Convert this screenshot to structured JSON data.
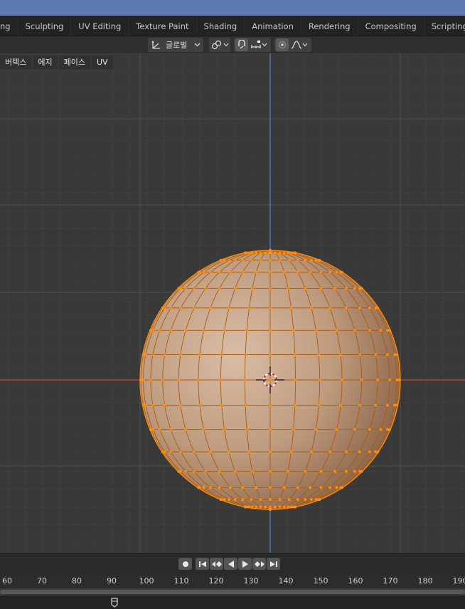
{
  "workspace_tabs": [
    {
      "label": "ng"
    },
    {
      "label": "Sculpting"
    },
    {
      "label": "UV Editing"
    },
    {
      "label": "Texture Paint"
    },
    {
      "label": "Shading"
    },
    {
      "label": "Animation"
    },
    {
      "label": "Rendering"
    },
    {
      "label": "Compositing"
    },
    {
      "label": "Scripting"
    }
  ],
  "add_tab": "+",
  "header": {
    "transform_orientation": "글로벌"
  },
  "mesh_menu": [
    "버텍스",
    "에지",
    "페이스",
    "UV"
  ],
  "timeline": {
    "frame_numbers": [
      "60",
      "70",
      "80",
      "90",
      "100",
      "110",
      "120",
      "130",
      "140",
      "150",
      "160",
      "170",
      "180",
      "190"
    ]
  },
  "icons": {
    "orientation": "transform-orientation-icon",
    "pivot": "pivot-link-icon",
    "snap": "snap-magnet-icon",
    "snap_target": "snap-increment-icon",
    "proportional": "proportional-edit-icon",
    "falloff": "falloff-curve-icon",
    "record": "record-icon",
    "jump_start": "jump-start-icon",
    "prev_key": "prev-keyframe-icon",
    "play_reverse": "play-reverse-icon",
    "play": "play-icon",
    "next_key": "next-keyframe-icon",
    "jump_end": "jump-end-icon",
    "playhead": "playhead-icon"
  },
  "colors": {
    "accent": "#5d7ab4",
    "selected_vertex": "#ff8c0a",
    "x_axis": "#b94848",
    "z_axis": "#4a7fb4",
    "mesh_surface": "#c7a58a"
  }
}
